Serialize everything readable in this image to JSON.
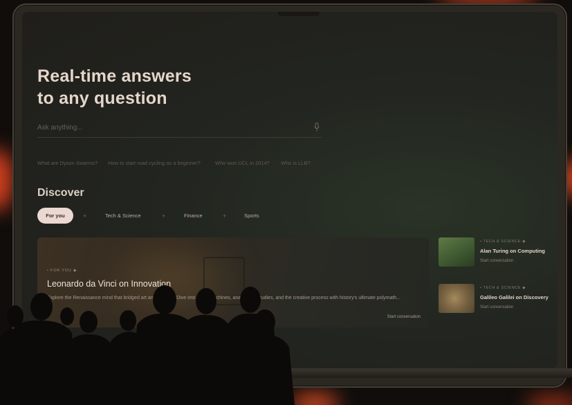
{
  "hero": {
    "title_line1": "Real-time answers",
    "title_line2": "to any question"
  },
  "search": {
    "placeholder": "Ask anything..."
  },
  "suggestions": [
    "What are Dyson Swarms?",
    "How to start road cycling as a beginner?",
    "Who won UCL in 2014?",
    "Who is LLB?"
  ],
  "discover": {
    "title": "Discover",
    "tabs": [
      "For you",
      "Tech & Science",
      "Finance",
      "Sports"
    ],
    "active_tab": "For you",
    "separator": "+"
  },
  "featured": {
    "tag": "• FOR YOU ◆",
    "title": "Leonardo da Vinci on Innovation",
    "description": "Explore the Renaissance mind that bridged art and science. Dive into flying machines, anatomical studies, and the creative process with history's ultimate polymath...",
    "cta": "Start conversation"
  },
  "side_cards": [
    {
      "tag": "• TECH & SCIENCE ◆",
      "title": "Alan Turing on Computing",
      "cta": "Start conversation"
    },
    {
      "tag": "• TECH & SCIENCE ◆",
      "title": "Galileo Galilei on Discovery",
      "cta": "Start conversation"
    }
  ],
  "colors": {
    "accent_pill": "#ecd8d2",
    "text_primary": "#e6d6cb",
    "background": "#221f1b",
    "stage_light": "#d2401e"
  },
  "icons": {
    "mic": "microphone-icon"
  }
}
